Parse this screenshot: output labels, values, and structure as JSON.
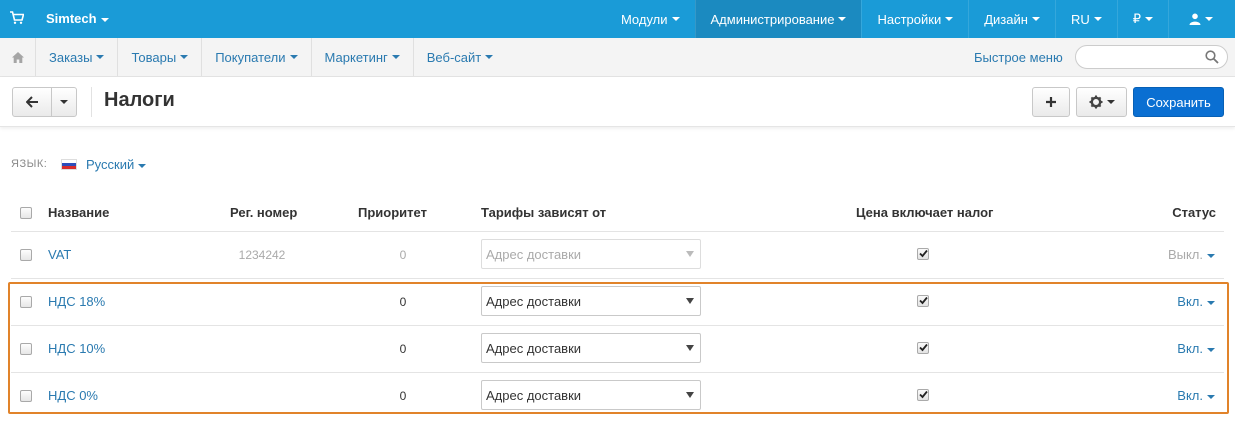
{
  "topbar": {
    "brand": "Simtech",
    "items": [
      {
        "label": "Модули",
        "active": false
      },
      {
        "label": "Администрирование",
        "active": true
      },
      {
        "label": "Настройки",
        "active": false
      },
      {
        "label": "Дизайн",
        "active": false
      },
      {
        "label": "RU",
        "active": false
      },
      {
        "label": "₽",
        "active": false
      }
    ],
    "icons": [
      "cart-icon",
      "user-icon"
    ]
  },
  "secondary_nav": {
    "items": [
      "Заказы",
      "Товары",
      "Покупатели",
      "Маркетинг",
      "Веб-сайт"
    ],
    "quick_menu": "Быстрое меню",
    "search_placeholder": ""
  },
  "toolbar": {
    "title": "Налоги",
    "save_label": "Сохранить"
  },
  "language": {
    "label": "ЯЗЫК:",
    "selected": "Русский"
  },
  "table": {
    "headers": {
      "name": "Название",
      "reg_number": "Рег. номер",
      "priority": "Приоритет",
      "rates_depend": "Тарифы зависят от",
      "price_includes": "Цена включает налог",
      "status": "Статус"
    },
    "rows": [
      {
        "name": "VAT",
        "reg_number": "1234242",
        "priority": "0",
        "rates_depend": "Адрес доставки",
        "price_includes_tax": true,
        "status": "Выкл.",
        "disabled": true
      },
      {
        "name": "НДС 18%",
        "reg_number": "",
        "priority": "0",
        "rates_depend": "Адрес доставки",
        "price_includes_tax": true,
        "status": "Вкл.",
        "disabled": false
      },
      {
        "name": "НДС 10%",
        "reg_number": "",
        "priority": "0",
        "rates_depend": "Адрес доставки",
        "price_includes_tax": true,
        "status": "Вкл.",
        "disabled": false
      },
      {
        "name": "НДС 0%",
        "reg_number": "",
        "priority": "0",
        "rates_depend": "Адрес доставки",
        "price_includes_tax": true,
        "status": "Вкл.",
        "disabled": false
      }
    ]
  },
  "colors": {
    "topbar": "#1a9bd7",
    "link": "#2a7ab0",
    "save_button": "#0a6fd2",
    "highlight": "#e1832a"
  }
}
